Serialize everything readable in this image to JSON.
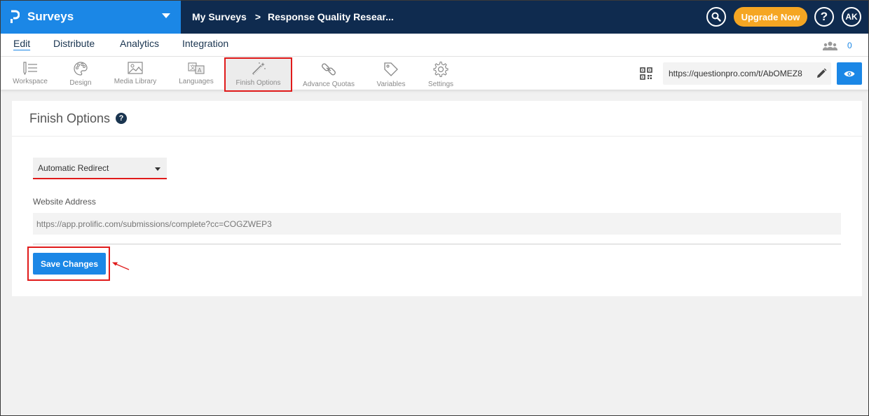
{
  "topbar": {
    "brand": "Surveys",
    "breadcrumb_home": "My Surveys",
    "breadcrumb_separator": ">",
    "breadcrumb_current": "Response Quality Resear...",
    "upgrade_label": "Upgrade Now",
    "help_label": "?",
    "avatar_initials": "AK"
  },
  "menu": {
    "tabs": [
      {
        "label": "Edit",
        "active": true
      },
      {
        "label": "Distribute",
        "active": false
      },
      {
        "label": "Analytics",
        "active": false
      },
      {
        "label": "Integration",
        "active": false
      }
    ],
    "collaborator_count": "0"
  },
  "toolbar": {
    "tools": [
      {
        "label": "Workspace",
        "icon": "workspace-icon"
      },
      {
        "label": "Design",
        "icon": "palette-icon"
      },
      {
        "label": "Media Library",
        "icon": "image-icon"
      },
      {
        "label": "Languages",
        "icon": "translate-icon"
      },
      {
        "label": "Finish Options",
        "icon": "magic-wand-icon",
        "active": true
      },
      {
        "label": "Advance Quotas",
        "icon": "link-chain-icon"
      },
      {
        "label": "Variables",
        "icon": "tag-icon"
      },
      {
        "label": "Settings",
        "icon": "gear-icon"
      }
    ],
    "survey_url": "https://questionpro.com/t/AbOMEZ8"
  },
  "panel": {
    "title": "Finish Options",
    "help_icon": "?",
    "finish_type": "Automatic Redirect",
    "website_label": "Website Address",
    "website_value": "https://app.prolific.com/submissions/complete?cc=COGZWEP3",
    "save_label": "Save Changes"
  },
  "colors": {
    "topbar": "#0f2b4f",
    "brand": "#1b87e6",
    "upgrade": "#f5a623",
    "annotation": "#e01b1b"
  }
}
